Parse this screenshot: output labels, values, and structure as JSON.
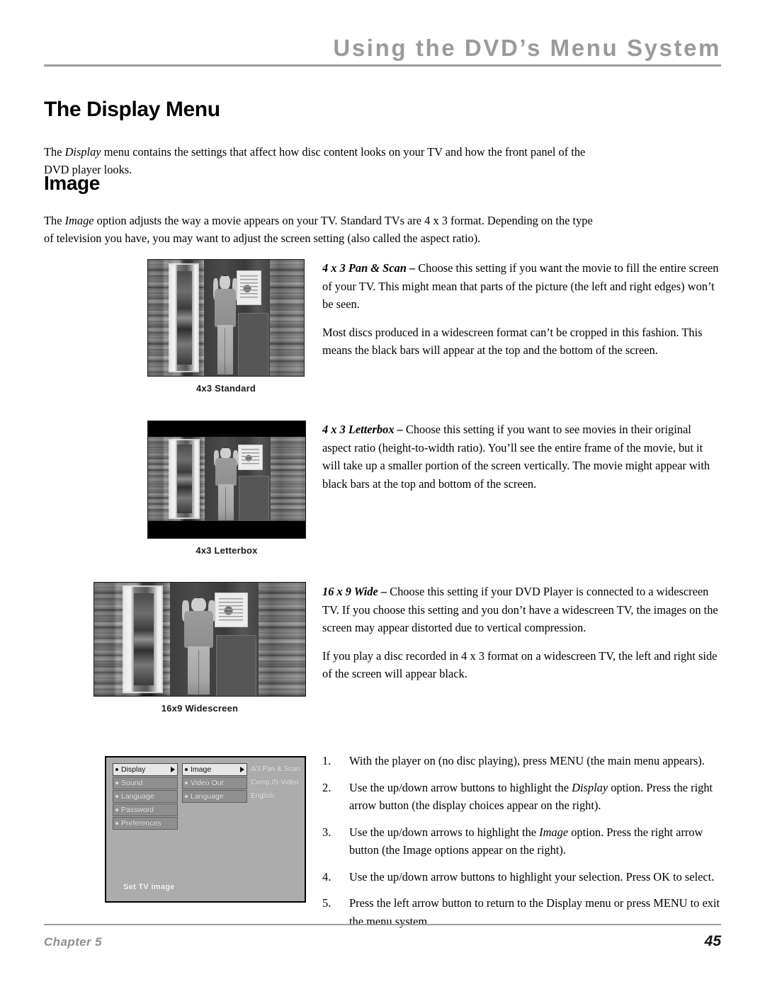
{
  "header": {
    "title": "Using the DVD’s Menu System"
  },
  "headings": {
    "display_menu": "The Display Menu",
    "image": "Image"
  },
  "paragraphs": {
    "intro_pre": "The ",
    "intro_em": "Display",
    "intro_post": " menu contains the settings that affect how disc content looks on your TV and how the front panel of the DVD player looks.",
    "image_pre": "The ",
    "image_em": "Image",
    "image_post": " option adjusts the way a movie appears on your TV. Standard TVs are 4 x 3 format. Depending on the type of television you have, you may want to adjust the screen setting (also called the aspect ratio)."
  },
  "descriptions": [
    {
      "lead": "4 x 3 Pan & Scan – ",
      "body": "Choose this setting if you want the movie to fill the entire screen of your TV. This might mean that parts of the picture (the left and right edges) won’t be seen.",
      "body2": "Most discs produced in a widescreen format can’t be cropped in this fashion. This means the black bars will appear at the top and the bottom of the screen."
    },
    {
      "lead": "4 x 3 Letterbox – ",
      "body": "Choose this setting if you want to see movies in their original aspect ratio (height-to-width ratio). You’ll see the entire frame of the movie, but it will take up a smaller portion of the screen vertically. The movie might appear with black bars at the top and bottom of the screen.",
      "body2": ""
    },
    {
      "lead": "16 x 9 Wide – ",
      "body": "Choose this setting if your DVD Player is connected to a widescreen TV. If you choose this setting and you don’t have a widescreen TV, the images on the screen may appear distorted due to vertical compression.",
      "body2": "If you play a disc recorded in 4 x 3 format on a widescreen TV, the left and right side of the screen will appear black."
    }
  ],
  "figures": [
    {
      "caption": "4x3 Standard"
    },
    {
      "caption": "4x3 Letterbox"
    },
    {
      "caption": "16x9 Widescreen"
    }
  ],
  "osd_menu": {
    "column1": [
      {
        "label": "Display",
        "selected": true,
        "arrow": true
      },
      {
        "label": "Sound",
        "selected": false,
        "arrow": false
      },
      {
        "label": "Language",
        "selected": false,
        "arrow": false
      },
      {
        "label": "Password",
        "selected": false,
        "arrow": false
      },
      {
        "label": "Preferences",
        "selected": false,
        "arrow": false
      }
    ],
    "column2": [
      {
        "label": "Image",
        "selected": true,
        "arrow": true
      },
      {
        "label": "Video Out",
        "selected": false,
        "arrow": false
      },
      {
        "label": "Language",
        "selected": false,
        "arrow": false
      }
    ],
    "values": [
      "4/3 Pan & Scan",
      "Comp./S-Video",
      "English"
    ],
    "footer": "Set TV image"
  },
  "steps": [
    {
      "num": "1.",
      "pre": "With the player on (no disc playing), press MENU (the main menu appears).",
      "em": "",
      "post": ""
    },
    {
      "num": "2.",
      "pre": "Use the up/down arrow buttons to highlight the ",
      "em": "Display",
      "post": " option. Press the right arrow button (the display choices appear on the right)."
    },
    {
      "num": "3.",
      "pre": "Use the up/down arrows to highlight the ",
      "em": "Image",
      "post": " option. Press the right arrow button (the Image options appear on the right)."
    },
    {
      "num": "4.",
      "pre": "Use the up/down arrow buttons to highlight your selection. Press OK to select.",
      "em": "",
      "post": ""
    },
    {
      "num": "5.",
      "pre": "Press the left arrow button to return to the Display menu or press MENU to exit the menu system.",
      "em": "",
      "post": ""
    }
  ],
  "footer": {
    "chapter": "Chapter 5",
    "page": "45"
  },
  "colors": {
    "header_gray": "#9a9a9a",
    "rule_gray": "#9d9d9d",
    "osd_background": "#acacac",
    "osd_item": "#8f8f8f",
    "osd_selected": "#e6e6e6"
  }
}
